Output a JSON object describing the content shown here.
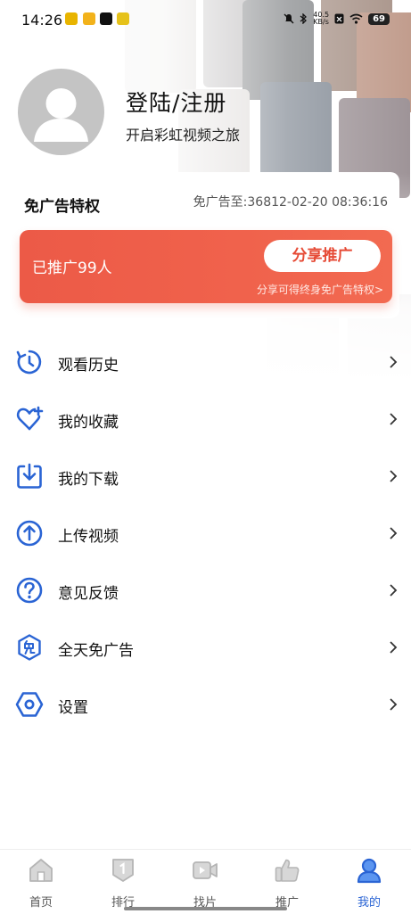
{
  "status_bar": {
    "time": "14:26",
    "net_speed_top": "40.5",
    "net_speed_unit": "KB/s",
    "battery": "69"
  },
  "profile": {
    "title": "登陆/注册",
    "subtitle": "开启彩虹视频之旅"
  },
  "ad_free": {
    "title": "免广告特权",
    "expire_label": "免广告至:",
    "expire_value": "36812-02-20 08:36:16",
    "promoted_count": "已推广99人",
    "share_button": "分享推广",
    "share_hint": "分享可得终身免广告特权>"
  },
  "menu": [
    {
      "label": "观看历史",
      "icon": "history-icon"
    },
    {
      "label": "我的收藏",
      "icon": "favorite-heart-icon"
    },
    {
      "label": "我的下载",
      "icon": "download-icon"
    },
    {
      "label": "上传视频",
      "icon": "upload-icon"
    },
    {
      "label": "意见反馈",
      "icon": "feedback-question-icon"
    },
    {
      "label": "全天免广告",
      "icon": "ad-free-badge-icon"
    },
    {
      "label": "设置",
      "icon": "settings-hexagon-icon"
    }
  ],
  "tabs": [
    {
      "label": "首页",
      "icon": "home-icon"
    },
    {
      "label": "排行",
      "icon": "ranking-icon"
    },
    {
      "label": "找片",
      "icon": "video-camera-icon"
    },
    {
      "label": "推广",
      "icon": "thumbs-up-icon"
    },
    {
      "label": "我的",
      "icon": "user-icon",
      "active": true
    }
  ],
  "colors": {
    "accent_blue": "#2a64d4",
    "promo_red": "#ec5a47",
    "avatar_gray": "#c4c4c4"
  }
}
